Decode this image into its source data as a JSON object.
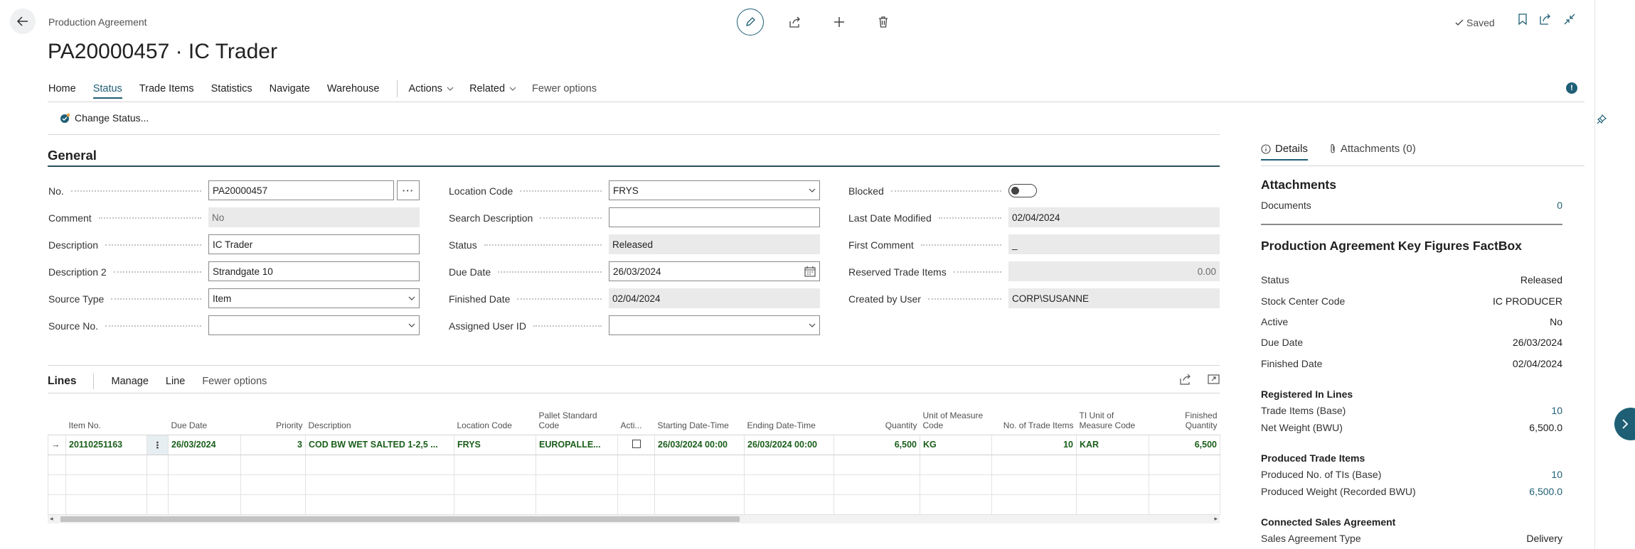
{
  "header": {
    "breadcrumb": "Production Agreement",
    "title": "PA20000457 · IC Trader",
    "saved_label": "Saved"
  },
  "tabs": [
    {
      "label": "Home"
    },
    {
      "label": "Status",
      "active": true
    },
    {
      "label": "Trade Items"
    },
    {
      "label": "Statistics"
    },
    {
      "label": "Navigate"
    },
    {
      "label": "Warehouse"
    }
  ],
  "menus": {
    "actions": "Actions",
    "related": "Related",
    "fewer": "Fewer options"
  },
  "action_bar": {
    "change_status": "Change Status..."
  },
  "general": {
    "title": "General",
    "no": {
      "label": "No.",
      "value": "PA20000457"
    },
    "comment": {
      "label": "Comment",
      "value": "No"
    },
    "description": {
      "label": "Description",
      "value": "IC Trader"
    },
    "description2": {
      "label": "Description 2",
      "value": "Strandgate 10"
    },
    "source_type": {
      "label": "Source Type",
      "value": "Item"
    },
    "source_no": {
      "label": "Source No.",
      "value": ""
    },
    "location_code": {
      "label": "Location Code",
      "value": "FRYS"
    },
    "search_description": {
      "label": "Search Description",
      "value": ""
    },
    "status": {
      "label": "Status",
      "value": "Released"
    },
    "due_date": {
      "label": "Due Date",
      "value": "26/03/2024"
    },
    "finished_date": {
      "label": "Finished Date",
      "value": "02/04/2024"
    },
    "assigned_user": {
      "label": "Assigned User ID",
      "value": ""
    },
    "blocked": {
      "label": "Blocked",
      "value": false
    },
    "last_modified": {
      "label": "Last Date Modified",
      "value": "02/04/2024"
    },
    "first_comment": {
      "label": "First Comment",
      "value": "_"
    },
    "reserved": {
      "label": "Reserved Trade Items",
      "value": "0.00"
    },
    "created_by": {
      "label": "Created by User",
      "value": "CORP\\SUSANNE"
    }
  },
  "lines": {
    "title": "Lines",
    "manage": "Manage",
    "line": "Line",
    "fewer": "Fewer options",
    "columns": {
      "item_no": "Item No.",
      "due_date": "Due Date",
      "priority": "Priority",
      "description": "Description",
      "location_code": "Location Code",
      "pallet": "Pallet Standard Code",
      "active": "Acti...",
      "start": "Starting Date-Time",
      "end": "Ending Date-Time",
      "quantity": "Quantity",
      "uom": "Unit of Measure Code",
      "no_ti": "No. of Trade Items",
      "ti_uom": "TI Unit of Measure Code",
      "finished_qty": "Finished Quantity"
    },
    "rows": [
      {
        "item_no": "20110251163",
        "due_date": "26/03/2024",
        "priority": "3",
        "description": "COD BW WET SALTED 1-2,5 ...",
        "location_code": "FRYS",
        "pallet": "EUROPALLE...",
        "start": "26/03/2024 00:00",
        "end": "26/03/2024 00:00",
        "quantity": "6,500",
        "uom": "KG",
        "no_ti": "10",
        "ti_uom": "KAR",
        "finished_qty": "6,500"
      }
    ]
  },
  "factbox": {
    "tab_details": "Details",
    "tab_attachments": "Attachments (0)",
    "attachments_title": "Attachments",
    "documents_label": "Documents",
    "documents_value": "0",
    "kf_title": "Production Agreement Key Figures FactBox",
    "status_label": "Status",
    "status_value": "Released",
    "stock_label": "Stock Center Code",
    "stock_value": "IC PRODUCER",
    "active_label": "Active",
    "active_value": "No",
    "due_label": "Due Date",
    "due_value": "26/03/2024",
    "finished_label": "Finished Date",
    "finished_value": "02/04/2024",
    "reg_title": "Registered In Lines",
    "ti_base_label": "Trade Items (Base)",
    "ti_base_value": "10",
    "net_weight_label": "Net Weight (BWU)",
    "net_weight_value": "6,500.0",
    "prod_title": "Produced Trade Items",
    "prod_no_label": "Produced No. of TIs (Base)",
    "prod_no_value": "10",
    "prod_weight_label": "Produced Weight (Recorded BWU)",
    "prod_weight_value": "6,500.0",
    "sales_title": "Connected Sales Agreement",
    "sales_type_label": "Sales Agreement Type",
    "sales_type_value": "Delivery"
  }
}
